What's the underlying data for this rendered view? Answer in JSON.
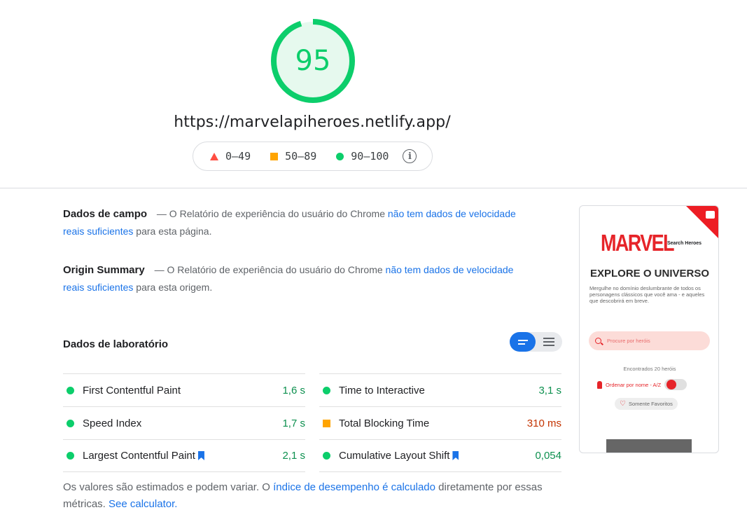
{
  "score": {
    "value": "95",
    "fraction": 0.95,
    "color": "#0cce6b",
    "url": "https://marvelapiheroes.netlify.app/"
  },
  "legend": {
    "fail": "0–49",
    "average": "50–89",
    "pass": "90–100",
    "info_glyph": "i"
  },
  "field_data": {
    "title": "Dados de campo",
    "text_before": "— O Relatório de experiência do usuário do Chrome",
    "link": "não tem dados de velocidade reais suficientes",
    "text_after": "para esta página."
  },
  "origin_summary": {
    "title": "Origin Summary",
    "text_before": "— O Relatório de experiência do usuário do Chrome",
    "link": "não tem dados de velocidade reais suficientes",
    "text_after": "para esta origem."
  },
  "lab_data": {
    "title": "Dados de laboratório",
    "metrics": [
      {
        "label": "First Contentful Paint",
        "value": "1,6 s",
        "status": "good"
      },
      {
        "label": "Time to Interactive",
        "value": "3,1 s",
        "status": "good"
      },
      {
        "label": "Speed Index",
        "value": "1,7 s",
        "status": "good"
      },
      {
        "label": "Total Blocking Time",
        "value": "310 ms",
        "status": "average"
      },
      {
        "label": "Largest Contentful Paint",
        "value": "2,1 s",
        "status": "good"
      },
      {
        "label": "Cumulative Layout Shift",
        "value": "0,054",
        "status": "good"
      }
    ]
  },
  "footnote": {
    "text1": "Os valores são estimados e podem variar. O ",
    "link1": "índice de desempenho é calculado",
    "text2": " diretamente por essas métricas. ",
    "link2": "See calculator."
  },
  "thumbnail": {
    "logo": "MARVEL",
    "logo_sub": "Search Heroes",
    "heading": "EXPLORE O UNIVERSO",
    "description": "Mergulhe no domínio deslumbrante de todos os personagens clássicos que você ama - e aqueles que descobrirá em breve.",
    "search_placeholder": "Procure por heróis",
    "found_text": "Encontrados 20 heróis",
    "order_label": "Ordenar por nome - A/Z",
    "favorites_label": "Somente Favoritos",
    "heart_glyph": "♡"
  },
  "colors": {
    "pass": "#0cce6b",
    "average": "#ffa400",
    "fail": "#ff4e42",
    "link": "#1a73e8",
    "marvel_red": "#e62429"
  }
}
